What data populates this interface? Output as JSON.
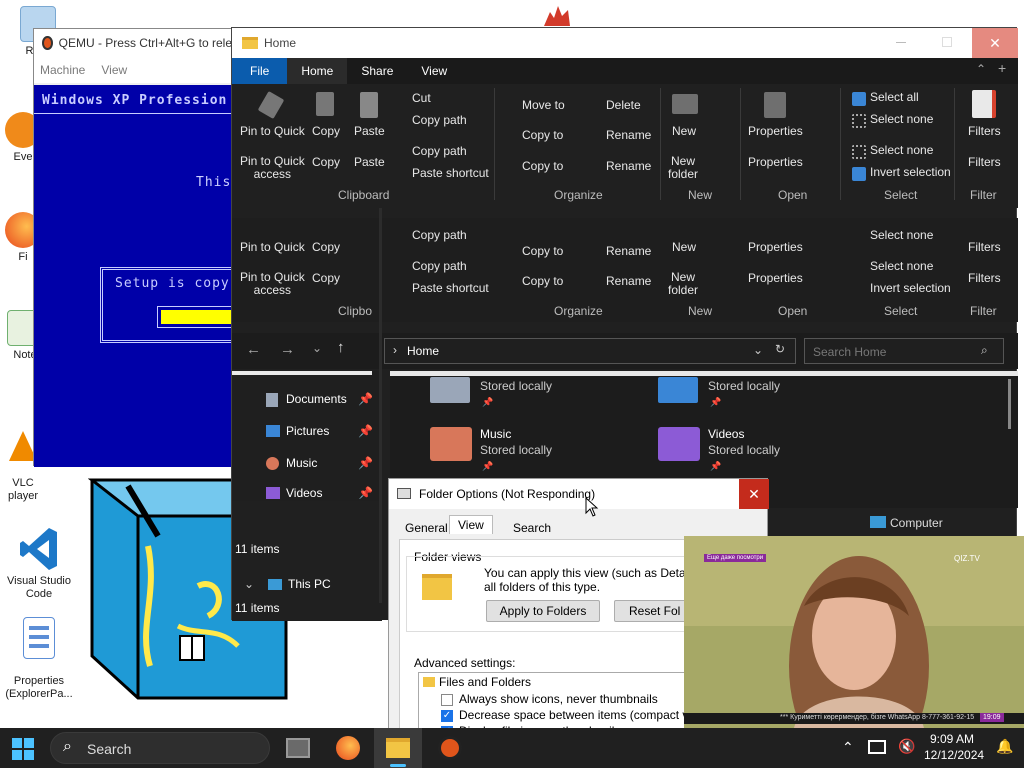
{
  "desktop": {
    "icons": [
      {
        "label": "Recy",
        "color": "#9ec5e6"
      },
      {
        "label": "Eve",
        "color": "#2b6fd0"
      },
      {
        "label": "Fi",
        "color": "#f26b1d"
      },
      {
        "label": "Note",
        "color": "#6fb06f"
      },
      {
        "label": "VLC\nplayer",
        "color": "#f08a00"
      },
      {
        "label": "Visual Studio\nCode",
        "color": "#1d78c8"
      },
      {
        "label": "Properties\n(ExplorerPa...",
        "color": "#5c8ed6"
      }
    ]
  },
  "qemu": {
    "title": "QEMU - Press Ctrl+Alt+G to rele",
    "menu": [
      "Machine",
      "View"
    ],
    "screen": {
      "header": "Windows XP Profession",
      "line1": "This",
      "box_text": "Setup is copy"
    }
  },
  "explorer": {
    "title": "Home",
    "tabs": [
      "File",
      "Home",
      "Share",
      "View"
    ],
    "active_tab": "Home",
    "ribbon": {
      "clipboard": {
        "pin_to_quick": "Pin to Quick",
        "pin_to_quick_access": "Pin to Quick\naccess",
        "copy": "Copy",
        "paste": "Paste",
        "cut": "Cut",
        "copy_path": "Copy path",
        "paste_shortcut": "Paste shortcut",
        "label": "Clipboard"
      },
      "organize": {
        "move_to": "Move to",
        "copy_to": "Copy to",
        "delete": "Delete",
        "rename": "Rename",
        "label": "Organize"
      },
      "new": {
        "new": "New",
        "new_folder": "New\nfolder",
        "label": "New"
      },
      "open": {
        "properties": "Properties",
        "label": "Open"
      },
      "select": {
        "select_all": "Select all",
        "select_none": "Select none",
        "invert_selection": "Invert selection",
        "label": "Select"
      },
      "filter": {
        "filters": "Filters",
        "label": "Filter"
      },
      "clipboard_trunc": "Clipbo",
      "paste_trunc": "Pas"
    },
    "address": {
      "location": "Home",
      "search_placeholder": "Search Home"
    },
    "nav_items": [
      {
        "label": "Documents",
        "icon": "documents-icon"
      },
      {
        "label": "Pictures",
        "icon": "pictures-icon"
      },
      {
        "label": "Music",
        "icon": "music-icon"
      },
      {
        "label": "Videos",
        "icon": "videos-icon"
      }
    ],
    "this_pc": "This PC",
    "status_items": "11 items",
    "status_items_bottom": "11 items",
    "content": [
      {
        "name": "",
        "sub": "Stored locally"
      },
      {
        "name": "",
        "sub": "Stored locally"
      },
      {
        "name": "Music",
        "sub": "Stored locally"
      },
      {
        "name": "Videos",
        "sub": "Stored locally"
      }
    ],
    "computer_label": "Computer"
  },
  "folder_options": {
    "title": "Folder Options (Not Responding)",
    "tabs": [
      "General",
      "View",
      "Search"
    ],
    "active_tab": "View",
    "folder_views_label": "Folder views",
    "folder_views_text": "You can apply this view (such as Details or",
    "folder_views_text2": "all folders of this type.",
    "apply_button": "Apply to Folders",
    "reset_button": "Reset Fol",
    "advanced_label": "Advanced settings:",
    "tree_root": "Files and Folders",
    "options": [
      {
        "label": "Always show icons, never thumbnails",
        "checked": false
      },
      {
        "label": "Decrease space between items (compact view)",
        "checked": true
      },
      {
        "label": "Display file icon on thumbnails",
        "checked": true
      }
    ]
  },
  "video": {
    "tag": "Еще даже посмотри",
    "brand": "QIZ.TV",
    "ticker": "*** Куриметті көрермендер, бізге WhatsApp 8-777-361-92-15",
    "time": "19:09"
  },
  "taskbar": {
    "search_label": "Search",
    "time": "9:09 AM",
    "date": "12/12/2024"
  },
  "colors": {
    "explorer_bg": "#202020",
    "ribbon_active": "#0b5cad",
    "xp_blue": "#0000a8",
    "taskbar": "#202020",
    "close_red": "#c42b1c"
  }
}
